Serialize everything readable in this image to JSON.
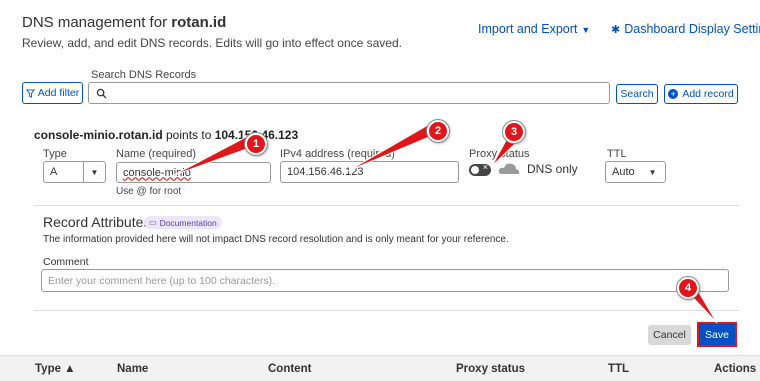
{
  "header": {
    "title_prefix": "DNS management for ",
    "domain": "rotan.id",
    "subtitle": "Review, add, and edit DNS records. Edits will go into effect once saved.",
    "import_export_label": "Import and Export",
    "dashboard_settings_label": "Dashboard Display Settings"
  },
  "toolbar": {
    "search_label": "Search DNS Records",
    "add_filter_label": "Add filter",
    "search_placeholder": "",
    "search_button_label": "Search",
    "add_record_label": "Add record"
  },
  "record_form": {
    "host": "console-minio.rotan.id",
    "points_to_text": " points to ",
    "target_ip": "104.156.46.123",
    "type_label": "Type",
    "type_value": "A",
    "name_label": "Name (required)",
    "name_value": "console-minio",
    "name_hint": "Use @ for root",
    "ipv4_label": "IPv4 address (required)",
    "ipv4_value": "104.156.46.123",
    "proxy_label": "Proxy status",
    "proxy_value": "DNS only",
    "ttl_label": "TTL",
    "ttl_value": "Auto"
  },
  "record_attributes": {
    "title": "Record Attributes",
    "doc_badge": "Documentation",
    "info": "The information provided here will not impact DNS record resolution and is only meant for your reference.",
    "comment_label": "Comment",
    "comment_placeholder": "Enter your comment here (up to 100 characters)."
  },
  "actions": {
    "cancel_label": "Cancel",
    "save_label": "Save"
  },
  "table": {
    "columns": [
      "Type ▲",
      "Name",
      "Content",
      "Proxy status",
      "TTL",
      "Actions"
    ]
  },
  "annotations": [
    "1",
    "2",
    "3",
    "4"
  ],
  "colors": {
    "accent": "#0051c3",
    "annotation": "#e0161a"
  }
}
